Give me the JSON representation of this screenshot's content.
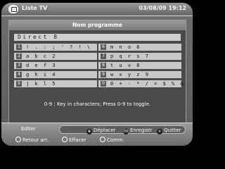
{
  "header": {
    "title": "Liste TV",
    "datetime": "03/08/09 19:12"
  },
  "dialog": {
    "title": "Nom programme",
    "input_value": "Direct 8",
    "keys_left": [
      {
        "num": "1",
        "chars": "! . : ; ' ? ! \\"
      },
      {
        "num": "2",
        "chars": "a b c 2"
      },
      {
        "num": "3",
        "chars": "d e f 3"
      },
      {
        "num": "4",
        "chars": "g h i 4"
      },
      {
        "num": "5",
        "chars": "j k l 5"
      }
    ],
    "keys_right": [
      {
        "num": "6",
        "chars": "m n o 6"
      },
      {
        "num": "7",
        "chars": "p q r s 7"
      },
      {
        "num": "8",
        "chars": "t u v 8"
      },
      {
        "num": "9",
        "chars": "w x y z 9"
      },
      {
        "num": "0",
        "chars": "0 + - * / = $ % &"
      }
    ],
    "hint": "0-9 : Key in characters; Press 0-9 to toggle."
  },
  "footer": {
    "mode": "Editer",
    "actions": [
      {
        "label": "Déplacer",
        "icon": "navigate-icon"
      },
      {
        "label": "Enregistr",
        "icon": "ok-icon"
      },
      {
        "label": "Quitter",
        "icon": "exit-icon"
      }
    ],
    "color_buttons": [
      {
        "label": "Retour arr."
      },
      {
        "label": "Effacer"
      },
      {
        "label": "Comm."
      }
    ]
  }
}
